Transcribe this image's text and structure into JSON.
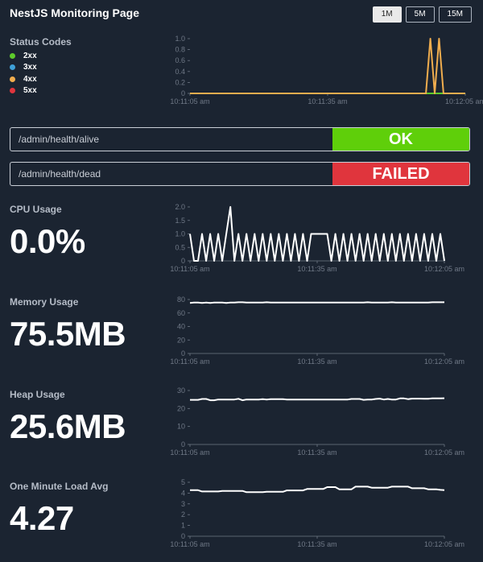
{
  "header": {
    "title": "NestJS Monitoring Page",
    "range_buttons": [
      "1M",
      "5M",
      "15M"
    ],
    "active_range": "1M"
  },
  "status_codes": {
    "title": "Status Codes",
    "legend": [
      {
        "label": "2xx",
        "color": "#5dcb2b"
      },
      {
        "label": "3xx",
        "color": "#3fa1d8"
      },
      {
        "label": "4xx",
        "color": "#f0ad4e"
      },
      {
        "label": "5xx",
        "color": "#e0353d"
      }
    ]
  },
  "health_checks": [
    {
      "path": "/admin/health/alive",
      "status": "OK",
      "color": "#5fcf0a"
    },
    {
      "path": "/admin/health/dead",
      "status": "FAILED",
      "color": "#e0353d"
    }
  ],
  "metrics": [
    {
      "title": "CPU Usage",
      "value": "0.0%"
    },
    {
      "title": "Memory Usage",
      "value": "75.5MB"
    },
    {
      "title": "Heap Usage",
      "value": "25.6MB"
    },
    {
      "title": "One Minute Load Avg",
      "value": "4.27"
    }
  ],
  "colors": {
    "background": "#1b2431",
    "line_2xx": "#5dcb2b",
    "line_4xx": "#f0ad4e",
    "metric_line": "#ffffff",
    "axis": "#6f7886"
  },
  "chart_data": [
    {
      "type": "line",
      "x_ticks": [
        "10:11:05 am",
        "10:11:35 am",
        "10:12:05 am"
      ],
      "y_ticks": [
        "0",
        "0.2",
        "0.4",
        "0.6",
        "0.8",
        "1.0"
      ],
      "ylim": [
        0,
        1.0
      ],
      "series": [
        {
          "name": "2xx",
          "values": [
            0,
            0,
            0,
            0,
            0,
            0,
            0,
            0,
            0,
            0,
            0,
            0,
            0,
            0,
            0,
            0,
            0,
            0,
            0,
            0,
            0,
            0,
            0,
            0,
            0,
            0,
            0,
            0,
            0,
            0,
            0,
            0,
            0,
            0,
            0,
            0,
            0,
            0,
            0,
            0,
            0,
            0,
            0,
            0,
            0,
            0,
            0,
            0,
            0,
            0,
            0,
            0,
            0,
            0,
            0,
            0,
            0,
            0,
            0,
            0,
            0,
            0,
            0,
            0
          ]
        },
        {
          "name": "4xx",
          "values": [
            0,
            0,
            0,
            0,
            0,
            0,
            0,
            0,
            0,
            0,
            0,
            0,
            0,
            0,
            0,
            0,
            0,
            0,
            0,
            0,
            0,
            0,
            0,
            0,
            0,
            0,
            0,
            0,
            0,
            0,
            0,
            0,
            0,
            0,
            0,
            0,
            0,
            0,
            0,
            0,
            0,
            0,
            0,
            0,
            0,
            0,
            0,
            0,
            0,
            0,
            0,
            0,
            0,
            0,
            0,
            1,
            0,
            1,
            0,
            0,
            0,
            0,
            0,
            0
          ]
        }
      ]
    },
    {
      "type": "line",
      "x_ticks": [
        "10:11:05 am",
        "10:11:35 am",
        "10:12:05 am"
      ],
      "y_ticks": [
        "0",
        "0.5",
        "1.0",
        "1.5",
        "2.0"
      ],
      "ylim": [
        0,
        2.0
      ],
      "series": [
        {
          "values": [
            1,
            0,
            0,
            1,
            0,
            1,
            0,
            1,
            0,
            1,
            2,
            0,
            1,
            0,
            1,
            0,
            1,
            0,
            1,
            0,
            1,
            0,
            1,
            0,
            1,
            0,
            1,
            0,
            1,
            0,
            1,
            1,
            1,
            1,
            1,
            0,
            1,
            0,
            1,
            0,
            1,
            0,
            1,
            0,
            1,
            0,
            1,
            0,
            1,
            0,
            1,
            0,
            1,
            0,
            1,
            0,
            1,
            0,
            1,
            0,
            1,
            0,
            1,
            0
          ]
        }
      ]
    },
    {
      "type": "line",
      "x_ticks": [
        "10:11:05 am",
        "10:11:35 am",
        "10:12:05 am"
      ],
      "y_ticks": [
        "0",
        "20",
        "40",
        "60",
        "80"
      ],
      "ylim": [
        0,
        80
      ],
      "series": [
        {
          "values": [
            75,
            75.5,
            75.5,
            75,
            75.5,
            75,
            75.5,
            75.5,
            75.5,
            75,
            75.5,
            75.5,
            76,
            76,
            75.5,
            75.5,
            75.5,
            75.5,
            75.5,
            76,
            75.5,
            75.5,
            75.5,
            75.5,
            75.5,
            75.5,
            75.5,
            75.5,
            75.5,
            75.5,
            75.5,
            75.5,
            75.5,
            75.5,
            75.5,
            75.5,
            75.5,
            75.5,
            75.5,
            75.5,
            75.5,
            75.5,
            75.5,
            75.5,
            76,
            75.5,
            75.5,
            75.5,
            75.5,
            75.5,
            76,
            75.5,
            75.5,
            75.5,
            75.5,
            75.5,
            75.5,
            75.5,
            75.5,
            75.5,
            76,
            76,
            76,
            76
          ]
        }
      ]
    },
    {
      "type": "line",
      "x_ticks": [
        "10:11:05 am",
        "10:11:35 am",
        "10:12:05 am"
      ],
      "y_ticks": [
        "0",
        "10",
        "20",
        "30"
      ],
      "ylim": [
        0,
        30
      ],
      "series": [
        {
          "values": [
            24.8,
            24.8,
            24.8,
            25.3,
            25.3,
            24.6,
            24.6,
            25,
            25,
            25,
            25,
            25,
            25.4,
            24.6,
            25,
            25,
            25,
            25,
            25.2,
            25,
            25.2,
            25.2,
            25.2,
            25.2,
            25,
            25,
            25,
            25,
            25,
            25,
            25,
            25,
            25,
            25,
            25,
            25,
            25,
            25,
            25,
            25,
            25.3,
            25.3,
            25.3,
            24.8,
            25,
            25,
            25.3,
            25.5,
            25,
            25.3,
            25,
            25,
            25.6,
            25.6,
            25.2,
            25.5,
            25.5,
            25.5,
            25.4,
            25.4,
            25.6,
            25.6,
            25.6,
            25.7
          ]
        }
      ]
    },
    {
      "type": "line",
      "x_ticks": [
        "10:11:05 am",
        "10:11:35 am",
        "10:12:05 am"
      ],
      "y_ticks": [
        "0",
        "1",
        "2",
        "3",
        "4",
        "5"
      ],
      "ylim": [
        0,
        5
      ],
      "series": [
        {
          "values": [
            4.27,
            4.27,
            4.27,
            4.15,
            4.15,
            4.15,
            4.15,
            4.15,
            4.2,
            4.2,
            4.2,
            4.2,
            4.2,
            4.2,
            4.08,
            4.08,
            4.08,
            4.08,
            4.08,
            4.12,
            4.12,
            4.12,
            4.12,
            4.12,
            4.25,
            4.25,
            4.25,
            4.25,
            4.25,
            4.38,
            4.38,
            4.38,
            4.38,
            4.38,
            4.55,
            4.55,
            4.55,
            4.35,
            4.35,
            4.35,
            4.35,
            4.6,
            4.6,
            4.6,
            4.6,
            4.5,
            4.5,
            4.5,
            4.5,
            4.5,
            4.6,
            4.6,
            4.6,
            4.6,
            4.6,
            4.45,
            4.45,
            4.45,
            4.45,
            4.35,
            4.35,
            4.35,
            4.3,
            4.27
          ]
        }
      ]
    }
  ]
}
